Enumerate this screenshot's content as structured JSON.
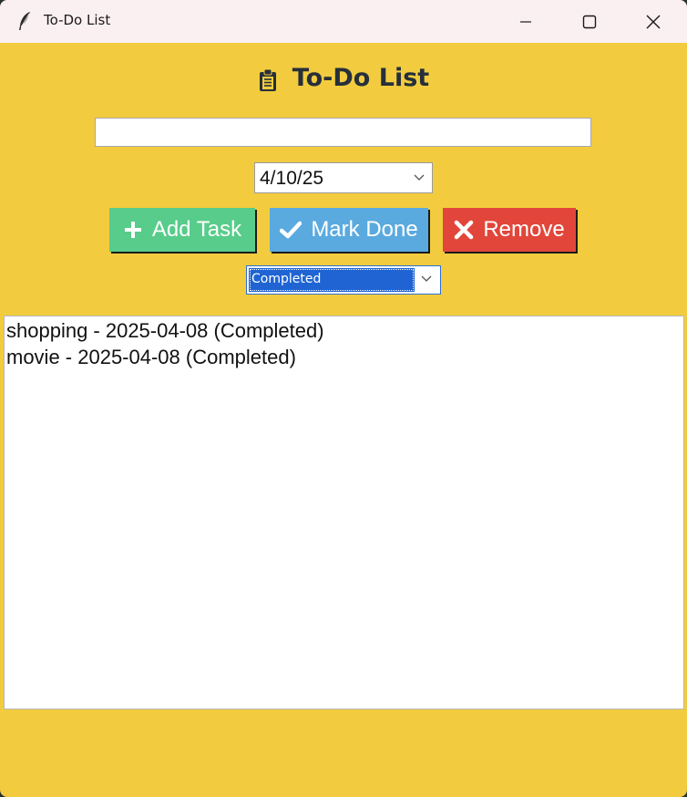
{
  "window": {
    "title": "To-Do List",
    "app_icon": "feather-icon",
    "controls": [
      "minimize-icon",
      "maximize-icon",
      "close-icon"
    ]
  },
  "header": {
    "icon": "clipboard-icon",
    "title": "To-Do List"
  },
  "task_input": {
    "value": "",
    "placeholder": ""
  },
  "date_picker": {
    "value": "4/10/25"
  },
  "buttons": {
    "add": {
      "label": "Add Task",
      "icon": "plus-icon",
      "color": "#58cc8a"
    },
    "done": {
      "label": "Mark Done",
      "icon": "check-icon",
      "color": "#5aaae0"
    },
    "remove": {
      "label": "Remove",
      "icon": "x-icon",
      "color": "#e2463a"
    }
  },
  "filter": {
    "value": "Completed"
  },
  "tasks": [
    {
      "text": "shopping - 2025-04-08 (Completed)"
    },
    {
      "text": "movie - 2025-04-08 (Completed)"
    }
  ],
  "colors": {
    "background": "#f2cc3e",
    "titlebar": "#faf0f2",
    "heading": "#262f3a"
  }
}
